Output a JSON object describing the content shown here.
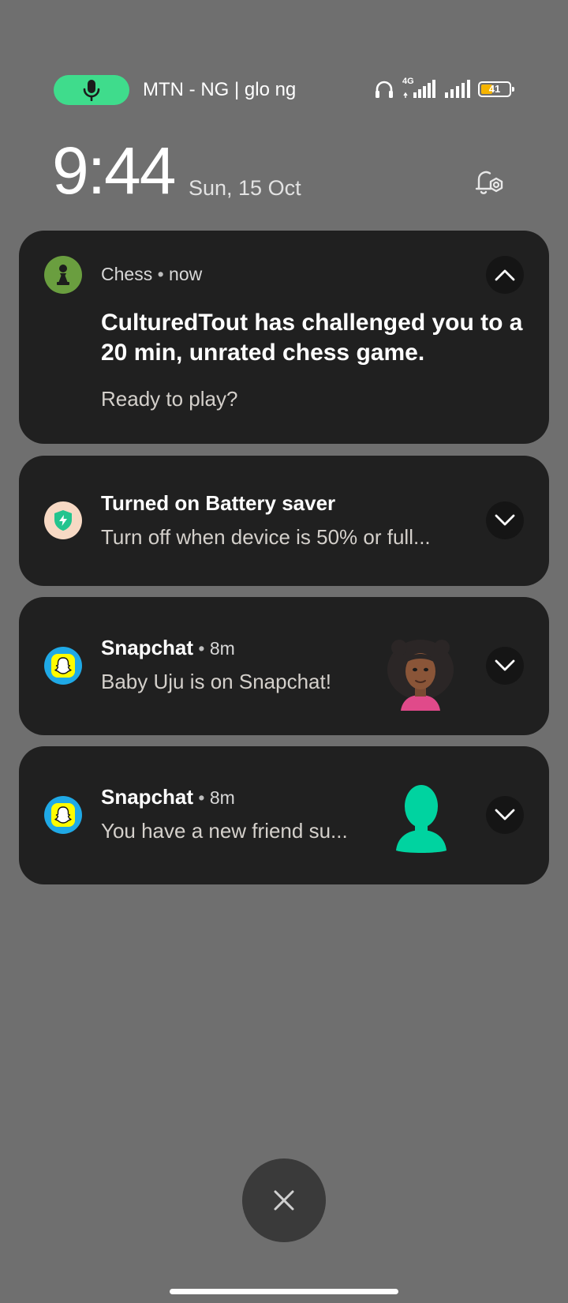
{
  "status_bar": {
    "carrier": "MTN - NG | glo ng",
    "network_type": "4G",
    "battery_level": "41",
    "battery_percent": 41,
    "icons": [
      "microphone-icon",
      "headphones-icon",
      "signal-icon",
      "battery-icon"
    ]
  },
  "lockscreen": {
    "time": "9:44",
    "date": "Sun, 15 Oct"
  },
  "notifications": [
    {
      "app": "Chess",
      "time": "now",
      "title": "CulturedTout has challenged you to a 20 min, unrated chess game.",
      "body": "Ready to play?",
      "icon": "chess-pawn-icon",
      "icon_color": "#6a9e3f",
      "expanded": true
    },
    {
      "title": "Turned on Battery saver",
      "body": "Turn off when device is 50% or full...",
      "icon": "battery-saver-icon",
      "icon_color": "#f7d9c4",
      "expanded": false
    },
    {
      "app": "Snapchat",
      "time": "8m",
      "body": "Baby Uju is on Snapchat!",
      "icon": "snapchat-ghost-icon",
      "icon_color": "#1fa9e6",
      "thumbnail": "bitmoji-avatar",
      "expanded": false
    },
    {
      "app": "Snapchat",
      "time": "8m",
      "body": "You have a new friend su...",
      "icon": "snapchat-ghost-icon",
      "icon_color": "#1fa9e6",
      "thumbnail": "default-avatar",
      "thumbnail_color": "#00d3a0",
      "expanded": false
    }
  ],
  "colors": {
    "background": "#6f6f6f",
    "card": "#202020",
    "mic_pill": "#3fdc8c",
    "battery_fill": "#f5b400"
  }
}
